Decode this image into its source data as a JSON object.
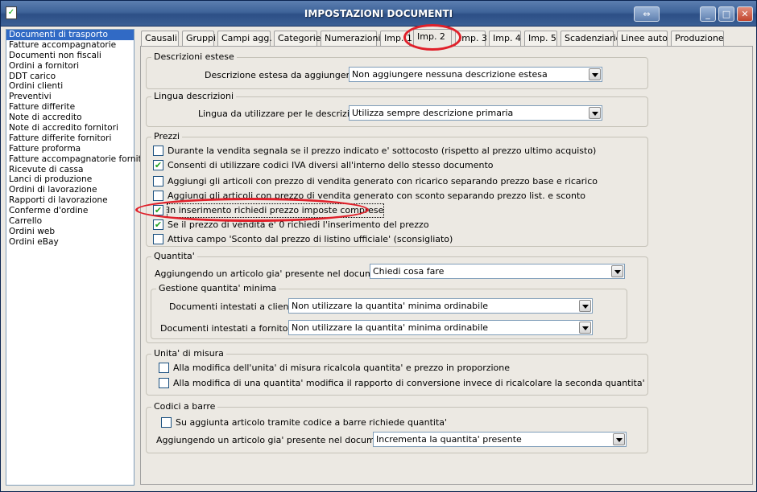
{
  "window": {
    "title": "IMPOSTAZIONI DOCUMENTI"
  },
  "titlebar_buttons": {
    "restore": "⇔",
    "minimize": "_",
    "maximize": "□",
    "close": "✕"
  },
  "sidebar": {
    "items": [
      "Documenti di trasporto",
      "Fatture accompagnatorie",
      "Documenti non fiscali",
      "Ordini a fornitori",
      "DDT carico",
      "Ordini clienti",
      "Preventivi",
      "Fatture differite",
      "Note di accredito",
      "Note di accredito fornitori",
      "Fatture differite fornitori",
      "Fatture proforma",
      "Fatture accompagnatorie fornito",
      "Ricevute di cassa",
      "Lanci di produzione",
      "Ordini di lavorazione",
      "Rapporti di lavorazione",
      "Conferme d'ordine",
      "Carrello",
      "Ordini web",
      "Ordini eBay"
    ],
    "selected": "Documenti di trasporto"
  },
  "tabs": [
    "Causali",
    "Gruppi",
    "Campi agg.",
    "Categorie",
    "Numerazioni",
    "Imp. 1",
    "Imp. 2",
    "Imp. 3",
    "Imp. 4",
    "Imp. 5",
    "Scadenziario",
    "Linee auto",
    "Produzione"
  ],
  "active_tab": "Imp. 2",
  "descrizioni_estese": {
    "title": "Descrizioni estese",
    "label": "Descrizione estesa da aggiungere :",
    "value": "Non aggiungere nessuna descrizione estesa"
  },
  "lingua": {
    "title": "Lingua descrizioni",
    "label": "Lingua da utilizzare per le descrizioni :",
    "value": "Utilizza sempre descrizione primaria"
  },
  "prezzi": {
    "title": "Prezzi",
    "options": [
      {
        "label": "Durante la vendita segnala se il prezzo indicato e' sottocosto (rispetto al prezzo ultimo acquisto)",
        "checked": false
      },
      {
        "label": "Consenti di utilizzare codici IVA diversi all'interno dello stesso documento",
        "checked": true
      },
      {
        "label": "Aggiungi gli articoli con prezzo di vendita generato con ricarico separando prezzo base e ricarico",
        "checked": false
      },
      {
        "label": "Aggiungi gli articoli con prezzo di vendita generato con sconto separando prezzo list. e sconto",
        "checked": false
      },
      {
        "label": "In inserimento richiedi prezzo imposte comprese",
        "checked": true
      },
      {
        "label": "Se il prezzo di vendita e' 0 richiedi l'inserimento del prezzo",
        "checked": true
      },
      {
        "label": "Attiva campo 'Sconto dal prezzo di listino ufficiale' (sconsigliato)",
        "checked": false
      }
    ]
  },
  "quantita": {
    "title": "Quantita'",
    "label": "Aggiungendo un articolo gia' presente nel documento :",
    "value": "Chiedi cosa fare",
    "minima": {
      "title": "Gestione quantita' minima",
      "clienti_label": "Documenti intestati a clienti :",
      "clienti_value": "Non utilizzare la quantita' minima ordinabile",
      "fornitori_label": "Documenti intestati a fornitori :",
      "fornitori_value": "Non utilizzare la quantita' minima ordinabile"
    }
  },
  "unita": {
    "title": "Unita' di misura",
    "options": [
      {
        "label": "Alla modifica dell'unita' di misura ricalcola quantita' e prezzo in proporzione",
        "checked": false
      },
      {
        "label": "Alla modifica di una quantita' modifica il rapporto di conversione invece di ricalcolare la seconda quantita'",
        "checked": false
      }
    ]
  },
  "barre": {
    "title": "Codici a barre",
    "option": {
      "label": "Su aggiunta articolo tramite codice a barre richiede quantita'",
      "checked": false
    },
    "label": "Aggiungendo un articolo gia' presente nel documento :",
    "value": "Incrementa la quantita' presente"
  },
  "colors": {
    "highlight": "#e0202a",
    "selection": "#316ac5",
    "check": "#21a121"
  }
}
